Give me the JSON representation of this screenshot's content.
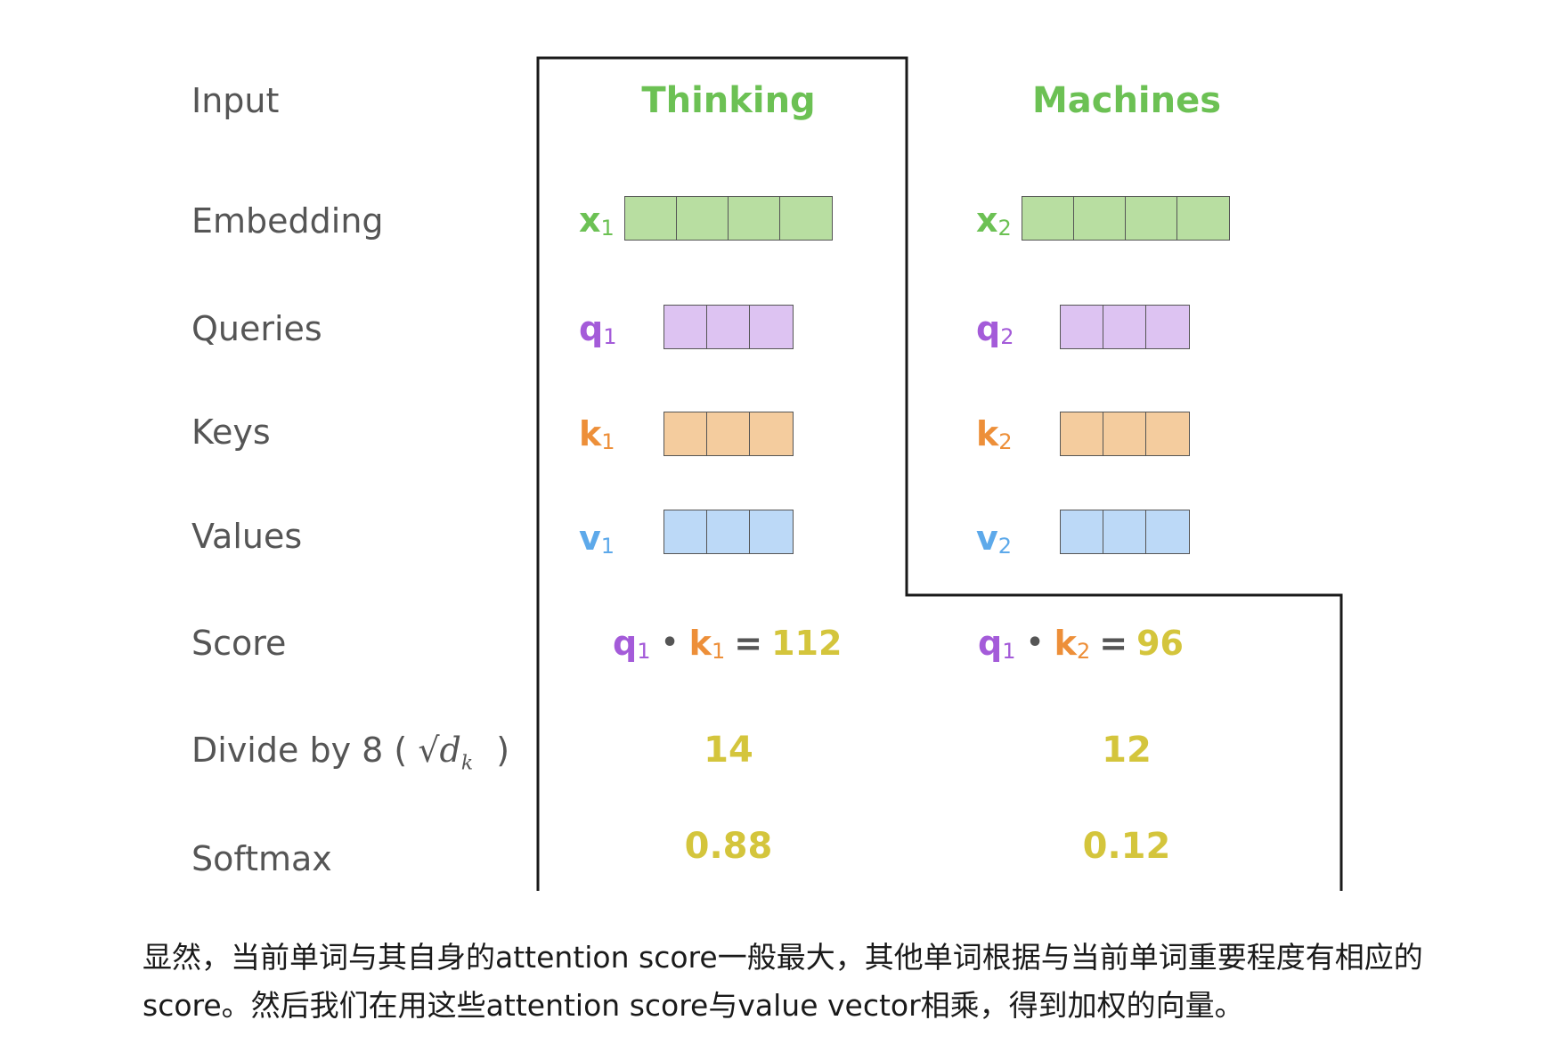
{
  "rows": {
    "input": "Input",
    "embedding": "Embedding",
    "queries": "Queries",
    "keys": "Keys",
    "values": "Values",
    "score": "Score",
    "divide": "Divide by 8 (",
    "divide_close": ")",
    "softmax": "Softmax"
  },
  "sqrt_label": "√d",
  "sqrt_sub": "k",
  "words": [
    "Thinking",
    "Machines"
  ],
  "columns": [
    {
      "x_sym": "x",
      "x_sub": "1",
      "q_sym": "q",
      "q_sub": "1",
      "k_sym": "k",
      "k_sub": "1",
      "v_sym": "v",
      "v_sub": "1",
      "score_q": "q",
      "score_q_sub": "1",
      "score_k": "k",
      "score_k_sub": "1",
      "score_dot": "•",
      "score_eq": "=",
      "score_value": "112",
      "divided": "14",
      "softmax": "0.88"
    },
    {
      "x_sym": "x",
      "x_sub": "2",
      "q_sym": "q",
      "q_sub": "2",
      "k_sym": "k",
      "k_sub": "2",
      "v_sym": "v",
      "v_sub": "2",
      "score_q": "q",
      "score_q_sub": "1",
      "score_k": "k",
      "score_k_sub": "2",
      "score_dot": "•",
      "score_eq": "=",
      "score_value": "96",
      "divided": "12",
      "softmax": "0.12"
    }
  ],
  "colors": {
    "word": "#6cc154",
    "embedding": "#b8dea1",
    "query": "#ddc3f2",
    "key": "#f4cc9e",
    "value": "#bcd9f7",
    "number": "#d4c53c"
  },
  "caption": {
    "line1": "显然，当前单词与其自身的attention score一般最大，其他单词根据与当前单词重要程度有相应的",
    "line2": "score。然后我们在用这些attention score与value vector相乘，得到加权的向量。"
  }
}
